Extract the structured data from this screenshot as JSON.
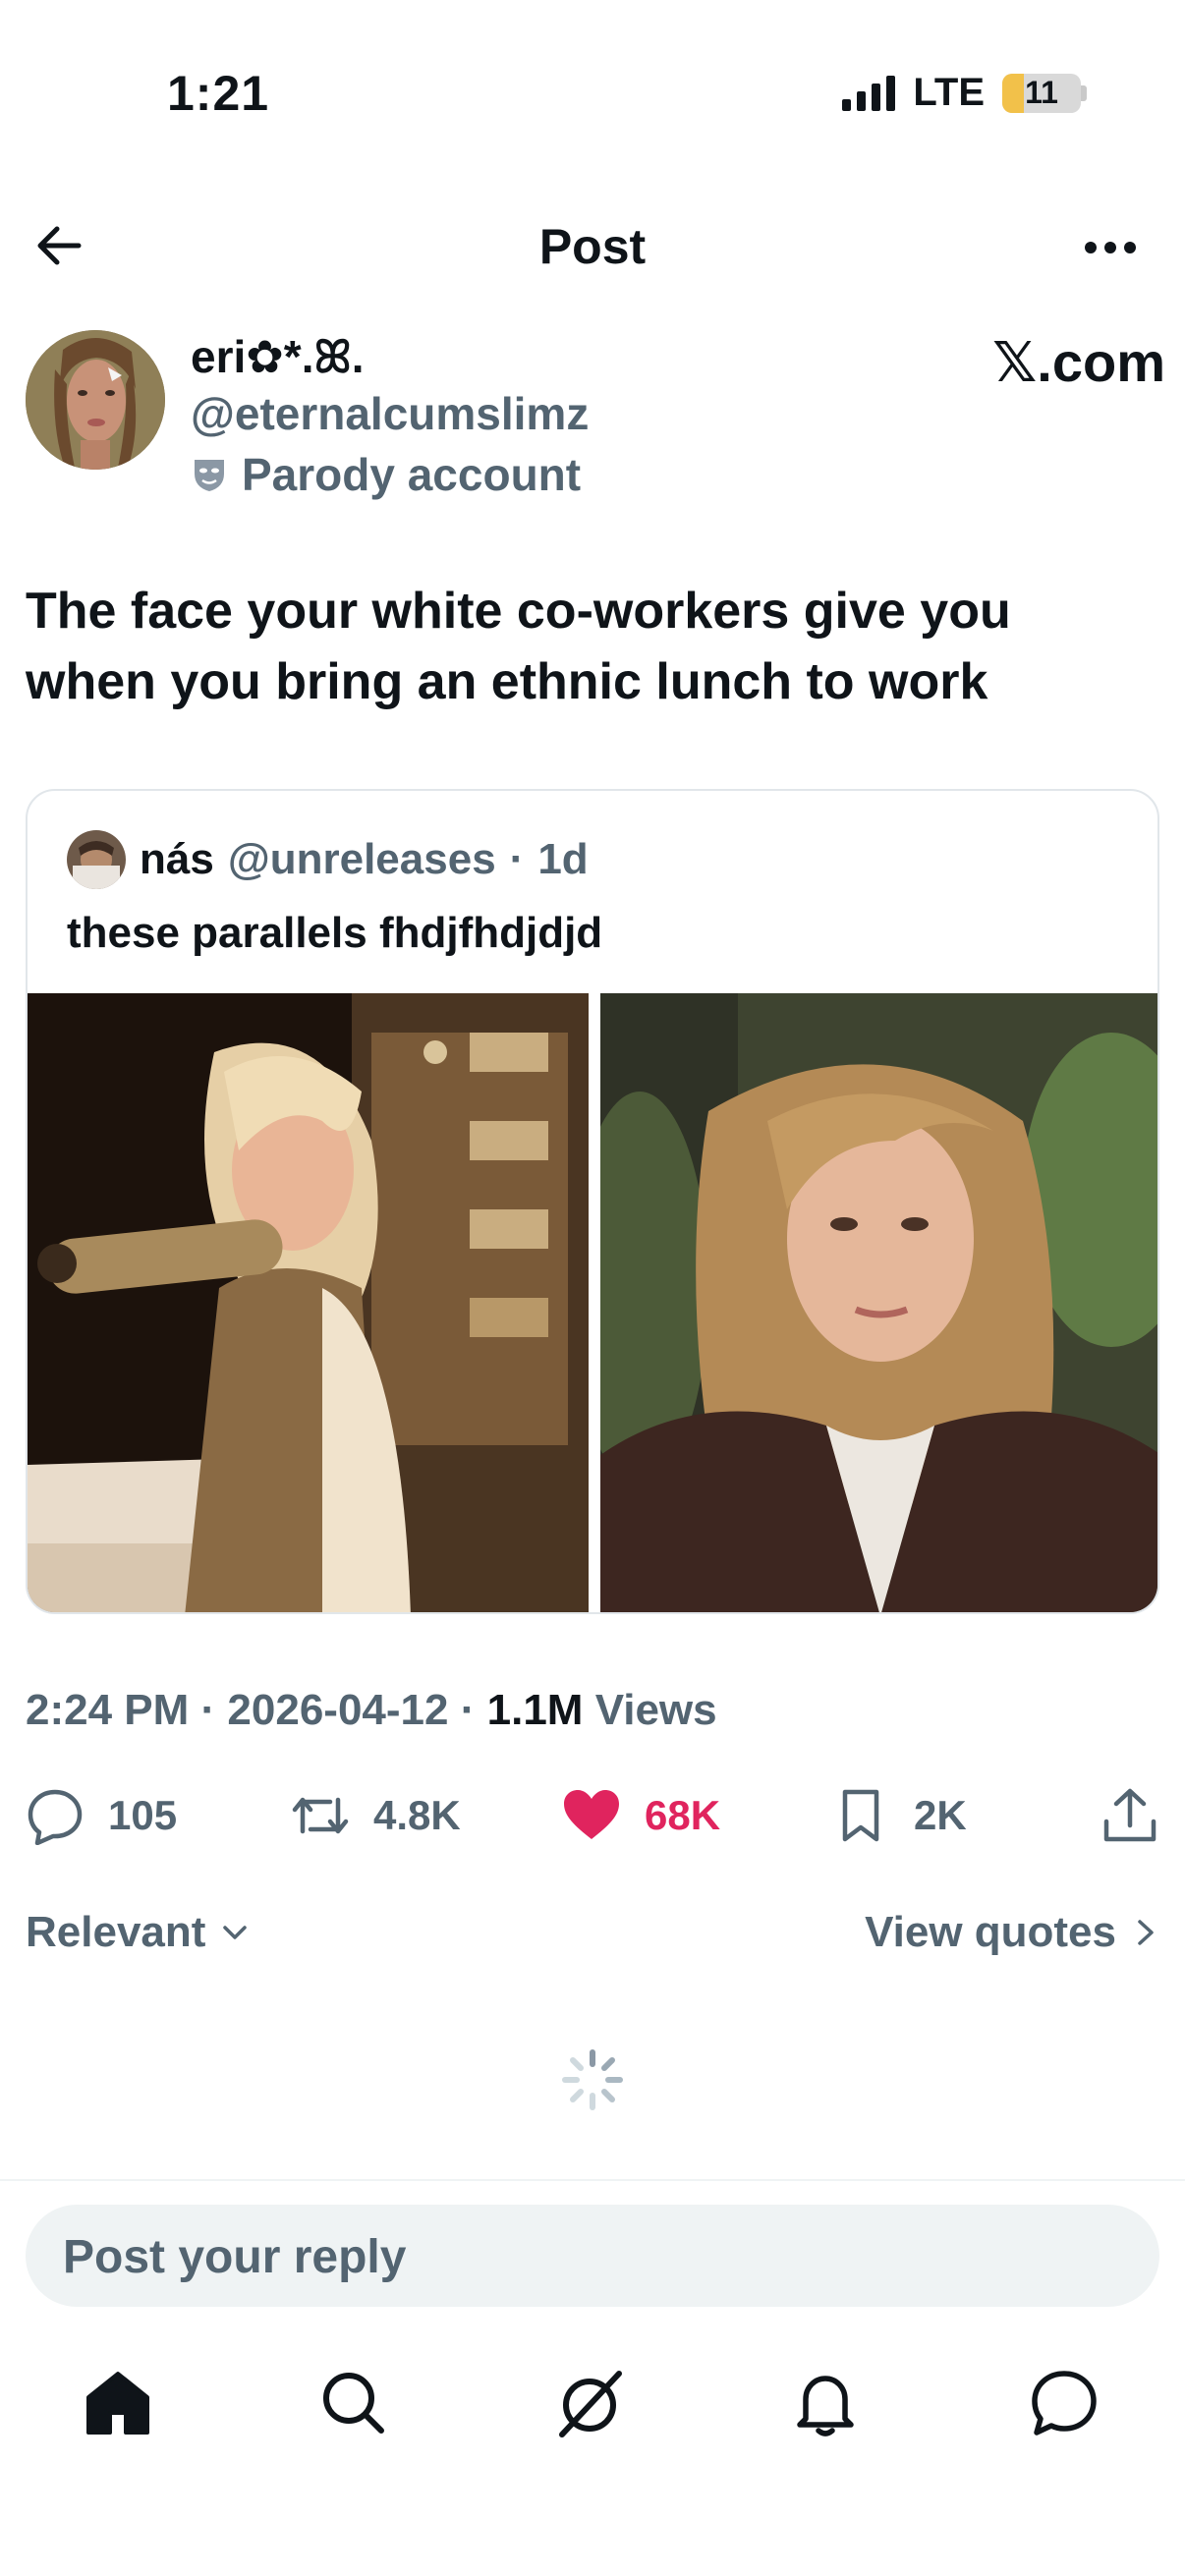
{
  "status_bar": {
    "time": "1:21",
    "network": "LTE",
    "battery": "11"
  },
  "nav": {
    "title": "Post"
  },
  "author": {
    "name": "eri✿*.ꕤ.",
    "handle": "@eternalcumslimz",
    "label": "Parody account",
    "source": "𝕏.com"
  },
  "post": {
    "text": "The face your white co-workers give you when you bring an ethnic lunch to work",
    "time": "2:24 PM",
    "date": "2026-04-12",
    "views_count": "1.1M",
    "views_label": "Views"
  },
  "quote": {
    "name": "nás",
    "handle": "@unreleases",
    "age": "1d",
    "text": "these parallels fhdjfhdjdjd"
  },
  "actions": {
    "replies": "105",
    "reposts": "4.8K",
    "likes": "68K",
    "bookmarks": "2K",
    "liked": true,
    "like_color": "#e0245e"
  },
  "sort": {
    "relevant_label": "Relevant",
    "view_quotes_label": "View quotes"
  },
  "reply": {
    "placeholder": "Post your reply"
  },
  "tabbar": {
    "items": [
      "home-icon",
      "search-icon",
      "grok-icon",
      "notifications-icon",
      "messages-icon"
    ]
  },
  "colors": {
    "text": "#0f1419",
    "secondary": "#536471",
    "border": "#e1e6ea",
    "like": "#e0245e"
  }
}
